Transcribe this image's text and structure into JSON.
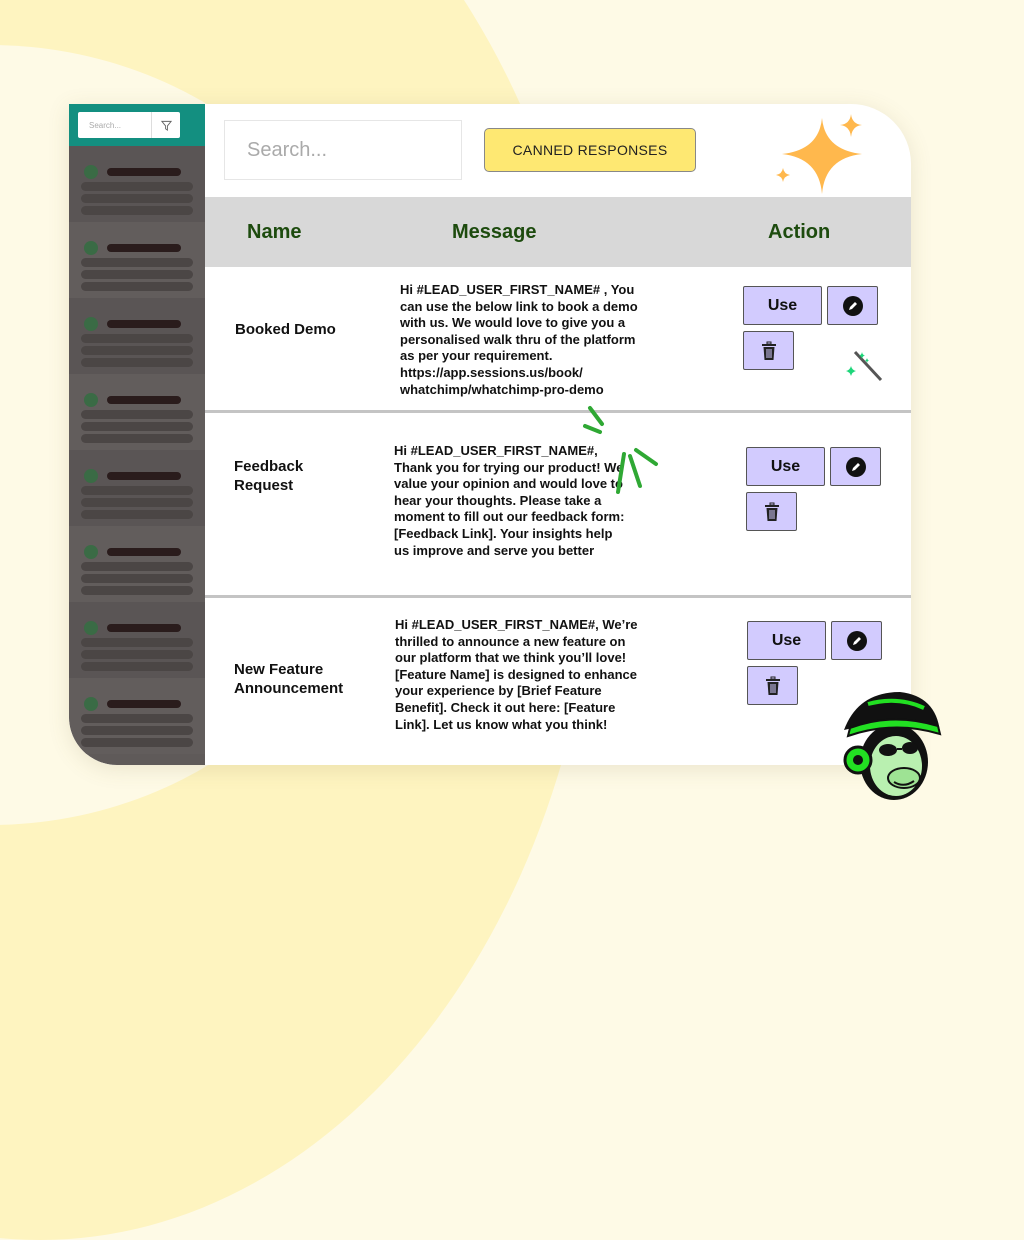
{
  "sidebar": {
    "search_placeholder": "Search...",
    "filter_icon": "filter-icon",
    "conversation_count": 8
  },
  "toolbar": {
    "search_placeholder": "Search...",
    "canned_responses_label": "CANNED RESPONSES"
  },
  "table": {
    "headers": {
      "name": "Name",
      "message": "Message",
      "action": "Action"
    },
    "rows": [
      {
        "name": "Booked Demo",
        "message": "Hi #LEAD_USER_FIRST_NAME# , You can use the below link to book a demo with us. We would love to give you a personalised walk thru of the platform as per your requirement. https://app.sessions.us/book/ whatchimp/whatchimp-pro-demo",
        "use_label": "Use"
      },
      {
        "name": "Feedback Request",
        "message": "Hi #LEAD_USER_FIRST_NAME#, Thank you for trying our product! We value your opinion and would love to hear your thoughts. Please take a moment to fill out our feedback form: [Feedback Link]. Your insights help us improve and serve you better",
        "use_label": "Use"
      },
      {
        "name": "New Feature Announcement",
        "message": "Hi #LEAD_USER_FIRST_NAME#, We’re thrilled to announce a new feature on our platform that we think you’ll love! [Feature Name] is designed to enhance your experience by [Brief Feature Benefit]. Check it out here: [Feature Link]. Let us know what you think!",
        "use_label": "Use"
      }
    ]
  },
  "icons": {
    "edit": "pencil-icon",
    "delete": "trash-icon",
    "decor": [
      "sparkle-icon",
      "magic-wand-icon",
      "burst-lines-icon",
      "chimp-mascot-icon"
    ]
  },
  "colors": {
    "sidebar_header": "#138f80",
    "accent_yellow": "#fee872",
    "action_button": "#d2cbfe",
    "header_text": "#1d4b0e",
    "sparkle": "#ffb84d",
    "mascot_green": "#22e022"
  }
}
